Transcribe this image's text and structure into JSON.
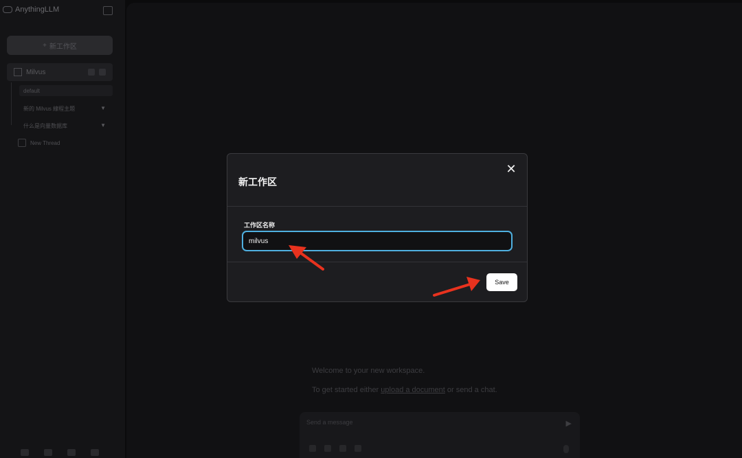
{
  "app": {
    "brand": "AnythingLLM",
    "new_workspace_label": "新工作区",
    "workspace_name": "Milvus",
    "threads": [
      {
        "label": "default"
      },
      {
        "label": "新的 Milvus 線程主題"
      },
      {
        "label": "什么是向量数据库"
      }
    ],
    "new_thread_label": "New Thread"
  },
  "main": {
    "welcome_line1": "Welcome to your new workspace.",
    "welcome_line2_prefix": "To get started either ",
    "welcome_line2_link": "upload a document",
    "welcome_line2_suffix": " or send a chat.",
    "message_placeholder": "Send a message"
  },
  "modal": {
    "title": "新工作区",
    "close_icon": "close-icon",
    "field_label": "工作区名称",
    "field_value": "milvus",
    "save_label": "Save"
  },
  "colors": {
    "accent_border": "#4fb0e0",
    "annotation_arrow": "#e8321e",
    "modal_bg": "#1d1d20"
  }
}
